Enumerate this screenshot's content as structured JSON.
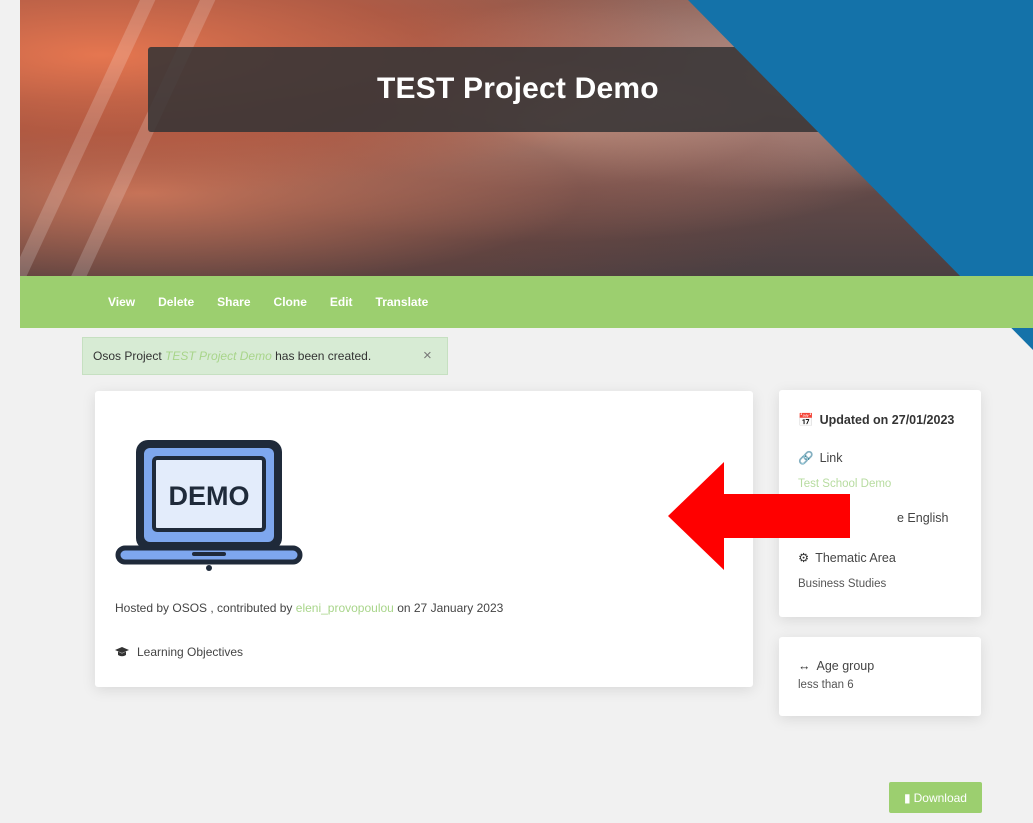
{
  "hero": {
    "title": "TEST Project Demo"
  },
  "nav": {
    "items": [
      "View",
      "Delete",
      "Share",
      "Clone",
      "Edit",
      "Translate"
    ]
  },
  "alert": {
    "prefix": "Osos Project",
    "project_name": "TEST Project Demo",
    "suffix": "has been created.",
    "close_symbol": "×"
  },
  "project": {
    "image_text": "DEMO",
    "hosted_prefix": "Hosted by OSOS , contributed by",
    "contributor": "eleni_provopoulou",
    "date_text": "on 27 January 2023",
    "learning_objectives_label": "Learning Objectives"
  },
  "sidebar": {
    "updated": "Updated on 27/01/2023",
    "link_label": "Link",
    "link_value": "Test School Demo",
    "language_value": "e English",
    "thematic_label": "Thematic Area",
    "thematic_value": "Business Studies",
    "age_label": "Age group",
    "age_value": "less than 6"
  },
  "download": {
    "label": "Download"
  },
  "colors": {
    "green": "#9ccf6f",
    "corner_blue": "#1472a9",
    "arrow_red": "#ff0000"
  }
}
